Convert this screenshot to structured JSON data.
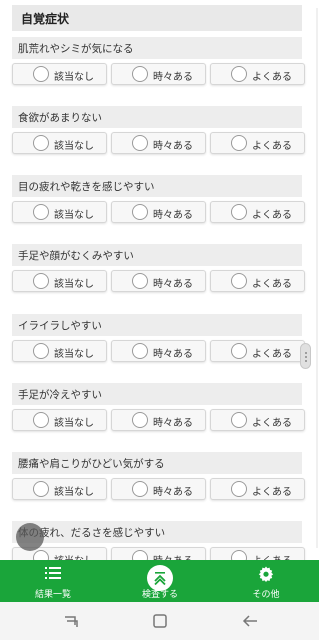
{
  "section": {
    "title": "自覚症状"
  },
  "questions": [
    {
      "label": "肌荒れやシミが気になる",
      "options": [
        "該当なし",
        "時々ある",
        "よくある"
      ]
    },
    {
      "label": "食欲があまりない",
      "options": [
        "該当なし",
        "時々ある",
        "よくある"
      ]
    },
    {
      "label": "目の疲れや乾きを感じやすい",
      "options": [
        "該当なし",
        "時々ある",
        "よくある"
      ]
    },
    {
      "label": "手足や顔がむくみやすい",
      "options": [
        "該当なし",
        "時々ある",
        "よくある"
      ]
    },
    {
      "label": "イライラしやすい",
      "options": [
        "該当なし",
        "時々ある",
        "よくある"
      ]
    },
    {
      "label": "手足が冷えやすい",
      "options": [
        "該当なし",
        "時々ある",
        "よくある"
      ]
    },
    {
      "label": "腰痛や肩こりがひどい気がする",
      "options": [
        "該当なし",
        "時々ある",
        "よくある"
      ]
    },
    {
      "label": "体の疲れ、だるさを感じやすい",
      "options": [
        "該当なし",
        "時々ある",
        "よくある"
      ]
    }
  ],
  "bottom_nav": {
    "items": [
      {
        "label": "結果一覧",
        "icon": "list-icon"
      },
      {
        "label": "検査する",
        "icon": "scan-icon"
      },
      {
        "label": "その他",
        "icon": "gear-icon"
      }
    ],
    "color": "#1aa53a"
  },
  "system_nav": {
    "icons": [
      "recent-apps-icon",
      "home-icon",
      "back-icon"
    ]
  }
}
